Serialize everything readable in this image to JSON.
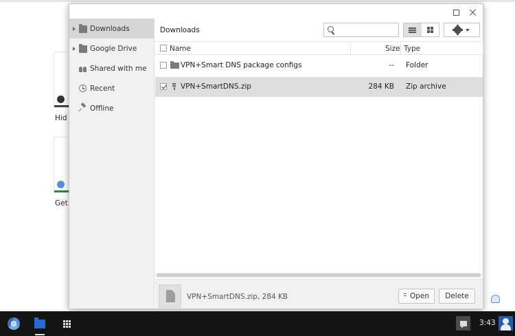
{
  "background": {
    "card_labels": [
      "Hid",
      "Get S"
    ]
  },
  "dialog": {
    "sidebar": {
      "items": [
        {
          "label": "Downloads",
          "icon": "downloads-folder-icon",
          "expandable": true,
          "selected": true
        },
        {
          "label": "Google Drive",
          "icon": "drive-icon",
          "expandable": true,
          "selected": false
        },
        {
          "label": "Shared with me",
          "icon": "shared-icon",
          "expandable": false,
          "selected": false
        },
        {
          "label": "Recent",
          "icon": "recent-clock-icon",
          "expandable": false,
          "selected": false
        },
        {
          "label": "Offline",
          "icon": "pin-icon",
          "expandable": false,
          "selected": false
        }
      ]
    },
    "toolbar": {
      "breadcrumb": "Downloads",
      "search_value": "",
      "search_placeholder": ""
    },
    "table": {
      "headers": {
        "name": "Name",
        "size": "Size",
        "type": "Type"
      },
      "rows": [
        {
          "name": "VPN+Smart DNS package configs",
          "size": "--",
          "type": "Folder",
          "icon": "folder-icon",
          "selected": false
        },
        {
          "name": "VPN+SmartDNS.zip",
          "size": "284 KB",
          "type": "Zip archive",
          "icon": "zip-file-icon",
          "selected": true
        }
      ]
    },
    "footer": {
      "preview_text": "VPN+SmartDNS.zip, 284 KB",
      "open_label": "Open",
      "delete_label": "Delete"
    }
  },
  "shelf": {
    "clock": "3:43"
  },
  "colors": {
    "shelf": "#141414",
    "sidebar": "#f1f1f1",
    "selected_row": "#dedede",
    "files_app_blue": "#2a6ad0"
  }
}
